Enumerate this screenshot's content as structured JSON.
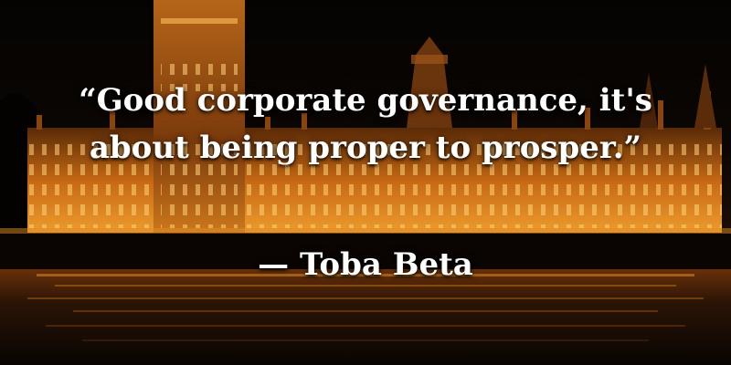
{
  "quote": {
    "line1": "“Good corporate governance, it's",
    "line2": "about being proper to prosper.”"
  },
  "author": "— Toba Beta",
  "colors": {
    "building_glow": "#f0a030",
    "sky": "#050302",
    "water": "#2a1406",
    "text": "#ffffff"
  }
}
